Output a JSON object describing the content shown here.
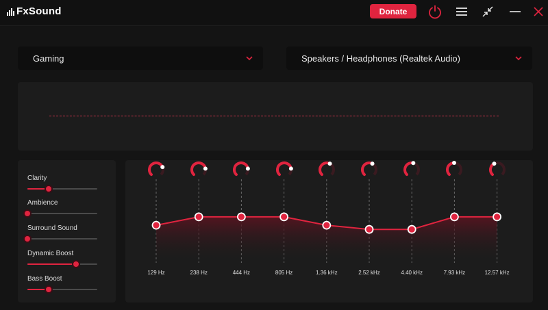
{
  "app": {
    "logo_text": "FxSound",
    "donate_label": "Donate",
    "icons": [
      "power-icon",
      "menu-icon",
      "minimize-to-compact-icon",
      "minimize-icon",
      "close-icon"
    ]
  },
  "preset": {
    "selected": "Gaming"
  },
  "output_device": {
    "selected": "Speakers / Headphones (Realtek Audio)"
  },
  "effects": [
    {
      "label": "Clarity",
      "value": 0.3
    },
    {
      "label": "Ambience",
      "value": 0.0
    },
    {
      "label": "Surround Sound",
      "value": 0.0
    },
    {
      "label": "Dynamic Boost",
      "value": 0.7
    },
    {
      "label": "Bass Boost",
      "value": 0.3
    }
  ],
  "equalizer": {
    "bands": [
      {
        "freq": "129 Hz",
        "level": 0.45
      },
      {
        "freq": "238 Hz",
        "level": 0.55
      },
      {
        "freq": "444 Hz",
        "level": 0.55
      },
      {
        "freq": "805 Hz",
        "level": 0.55
      },
      {
        "freq": "1.36 kHz",
        "level": 0.45
      },
      {
        "freq": "2.52 kHz",
        "level": 0.4
      },
      {
        "freq": "4.40 kHz",
        "level": 0.4
      },
      {
        "freq": "7.93 kHz",
        "level": 0.55
      },
      {
        "freq": "12.57 kHz",
        "level": 0.55
      }
    ],
    "dial_values": [
      0.75,
      0.8,
      0.8,
      0.8,
      0.6,
      0.6,
      0.55,
      0.5,
      0.4
    ]
  },
  "colors": {
    "accent": "#e0243f",
    "background": "#141414",
    "panel": "#1c1c1c"
  }
}
